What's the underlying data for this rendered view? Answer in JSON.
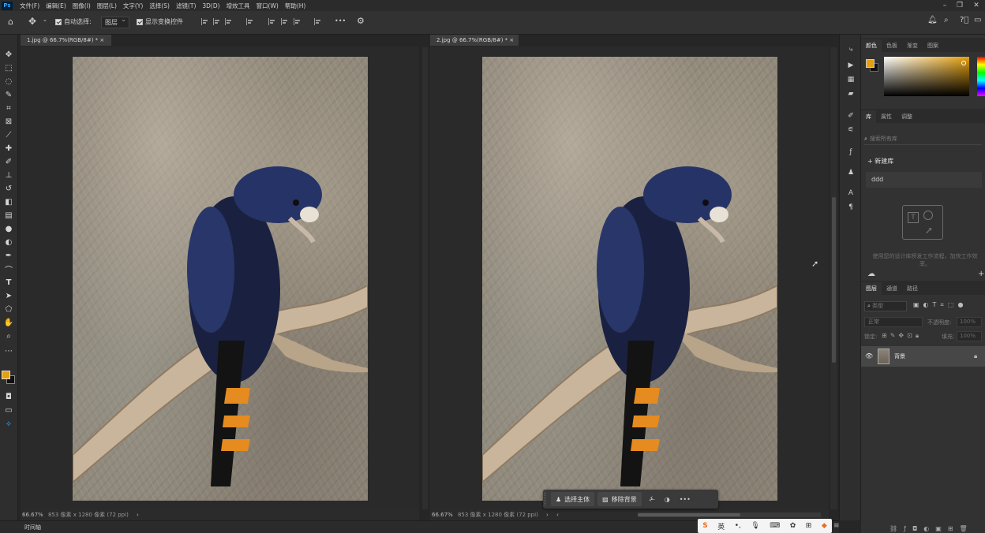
{
  "menubar": {
    "app_icon": "Ps",
    "items": [
      "文件(F)",
      "编辑(E)",
      "图像(I)",
      "图层(L)",
      "文字(Y)",
      "选择(S)",
      "滤镜(T)",
      "3D(D)",
      "增效工具",
      "窗口(W)",
      "帮助(H)"
    ]
  },
  "options": {
    "auto_select_label": "自动选择:",
    "auto_select_value": "图层",
    "show_transform_label": "显示变换控件",
    "more": "•••"
  },
  "documents": [
    {
      "tab": "1.jpg @ 66.7%(RGB/8#) *",
      "zoom": "66.67%",
      "info": "853 像素 x 1280 像素 (72 ppi)",
      "close": "×"
    },
    {
      "tab": "2.jpg @ 66.7%(RGB/8#) *",
      "zoom": "66.67%",
      "info": "853 像素 x 1280 像素 (72 ppi)",
      "close": "×"
    }
  ],
  "context_bar": {
    "select_subject": "选择主体",
    "remove_background": "移除背景",
    "more": "•••"
  },
  "panels": {
    "color_tabs": [
      "颜色",
      "色板",
      "渐变",
      "图案"
    ],
    "library_tabs": [
      "库",
      "属性",
      "调整"
    ],
    "search_placeholder": "搜索所有库",
    "new_library": "新建库",
    "library_name": "ddd",
    "drag_hint": "使用您的设计库桥发工作流程，加快工作效率。",
    "layers_tabs": [
      "图层",
      "通道",
      "路径"
    ],
    "filter_placeholder": "类型",
    "blend_mode": "正常",
    "opacity_label": "不透明度:",
    "opacity_value": "100%",
    "lock_label": "锁定:",
    "fill_label": "填充:",
    "fill_value": "100%",
    "layer_name": "背景"
  },
  "timeline": {
    "label": "时间轴"
  },
  "ime": {
    "lang": "英"
  },
  "colors": {
    "foreground": "#e5a00d",
    "background": "#111111",
    "accent": "#31a8ff"
  }
}
